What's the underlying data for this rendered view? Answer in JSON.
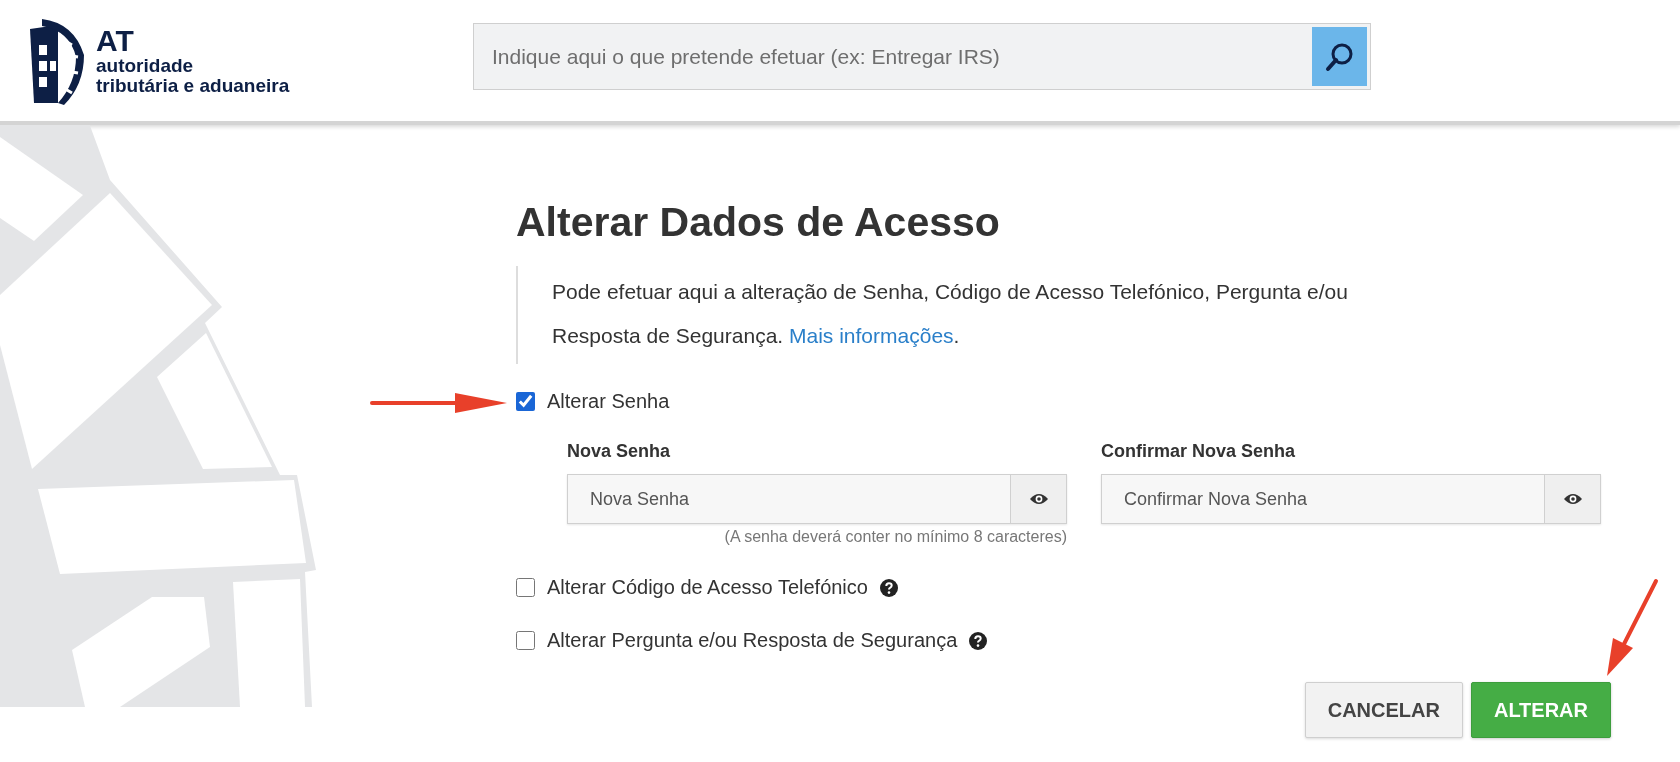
{
  "header": {
    "logo": {
      "abbr": "AT",
      "line_1": "autoridade",
      "line_2": "tributária e aduaneira"
    },
    "search": {
      "placeholder": "Indique aqui o que pretende efetuar (ex: Entregar IRS)"
    }
  },
  "page": {
    "title": "Alterar Dados de Acesso",
    "intro": "Pode efetuar aqui a alteração de Senha, Código de Acesso Telefónico, Pergunta e/ou Resposta de Segurança.",
    "intro_link": "Mais informações",
    "intro_end": "."
  },
  "options": [
    {
      "label": "Alterar Senha",
      "checked": true,
      "help": false,
      "fields": [
        {
          "label": "Nova Senha",
          "placeholder": "Nova Senha",
          "hint": "(A senha deverá conter no mínimo 8 caracteres)"
        },
        {
          "label": "Confirmar Nova Senha",
          "placeholder": "Confirmar Nova Senha"
        }
      ]
    },
    {
      "label": "Alterar Código de Acesso Telefónico",
      "checked": false,
      "help": true
    },
    {
      "label": "Alterar Pergunta e/ou Resposta de Segurança",
      "checked": false,
      "help": true
    }
  ],
  "buttons": [
    {
      "label": "CANCELAR",
      "kind": "secondary"
    },
    {
      "label": "ALTERAR",
      "kind": "primary"
    }
  ],
  "annotations": [
    {
      "kind": "arrow-right"
    },
    {
      "kind": "arrow-down-left"
    }
  ]
}
